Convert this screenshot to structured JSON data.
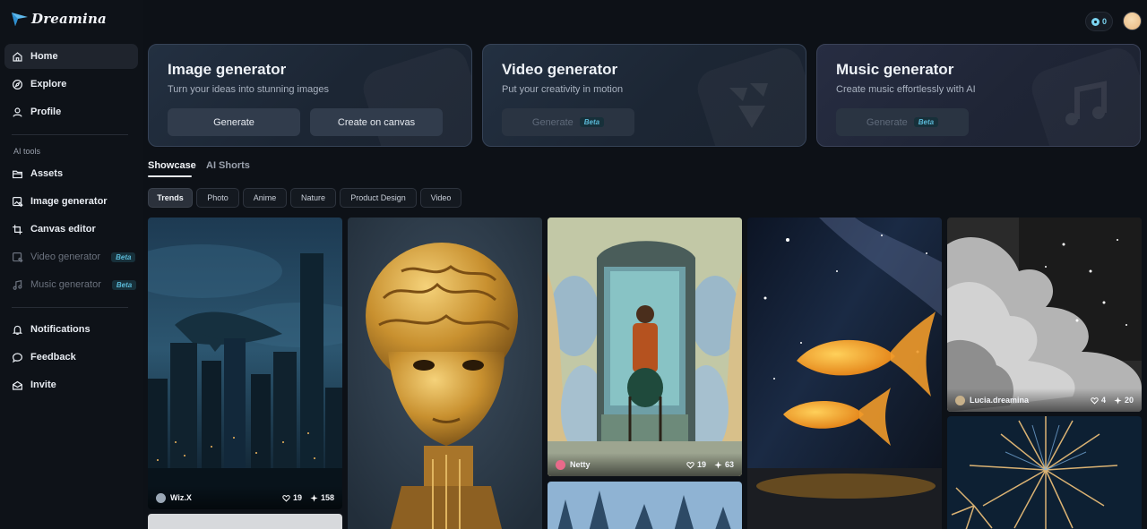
{
  "app": {
    "logo_text": "Dreamina",
    "credits": "0"
  },
  "sidebar": {
    "main_items": [
      {
        "label": "Home",
        "icon": "home-icon"
      },
      {
        "label": "Explore",
        "icon": "compass-icon"
      },
      {
        "label": "Profile",
        "icon": "user-icon"
      }
    ],
    "section_label": "AI tools",
    "tool_items": [
      {
        "label": "Assets",
        "icon": "folder-icon"
      },
      {
        "label": "Image generator",
        "icon": "image-edit-icon"
      },
      {
        "label": "Canvas editor",
        "icon": "crop-icon"
      },
      {
        "label": "Video generator",
        "icon": "video-icon",
        "badge": "Beta"
      },
      {
        "label": "Music generator",
        "icon": "music-icon",
        "badge": "Beta"
      }
    ],
    "bottom_items": [
      {
        "label": "Notifications",
        "icon": "bell-icon"
      },
      {
        "label": "Feedback",
        "icon": "chat-icon"
      },
      {
        "label": "Invite",
        "icon": "invite-icon"
      }
    ]
  },
  "generators": [
    {
      "title": "Image generator",
      "subtitle": "Turn your ideas into stunning images",
      "buttons": [
        "Generate",
        "Create on canvas"
      ]
    },
    {
      "title": "Video generator",
      "subtitle": "Put your creativity in motion",
      "buttons": [
        "Generate"
      ],
      "badge": "Beta"
    },
    {
      "title": "Music generator",
      "subtitle": "Create music effortlessly with AI",
      "buttons": [
        "Generate"
      ],
      "badge": "Beta"
    }
  ],
  "tabs": [
    "Showcase",
    "AI Shorts"
  ],
  "active_tab": "Showcase",
  "chips": [
    "Trends",
    "Photo",
    "Anime",
    "Nature",
    "Product Design",
    "Video"
  ],
  "active_chip": "Trends",
  "gallery": [
    {
      "description": "whale over night city",
      "user": "Wiz.X",
      "likes": "19",
      "uses": "158"
    },
    {
      "description": "golden brain humanoid",
      "user": "",
      "likes": "",
      "uses": ""
    },
    {
      "description": "man in chair before mirror with faces",
      "user": "Netty",
      "likes": "19",
      "uses": "63"
    },
    {
      "description": "goldfish in starry night",
      "user": "",
      "likes": "",
      "uses": ""
    },
    {
      "description": "grayscale clouds with stars",
      "user": "Lucia.dreamina",
      "likes": "4",
      "uses": "20"
    },
    {
      "description": "castle spires",
      "user": "",
      "likes": "",
      "uses": ""
    },
    {
      "description": "fireworks",
      "user": "",
      "likes": "",
      "uses": ""
    }
  ],
  "colors": {
    "accent": "#7ad3ef",
    "background": "#0d1117",
    "beta_text": "#5ab8d6"
  }
}
